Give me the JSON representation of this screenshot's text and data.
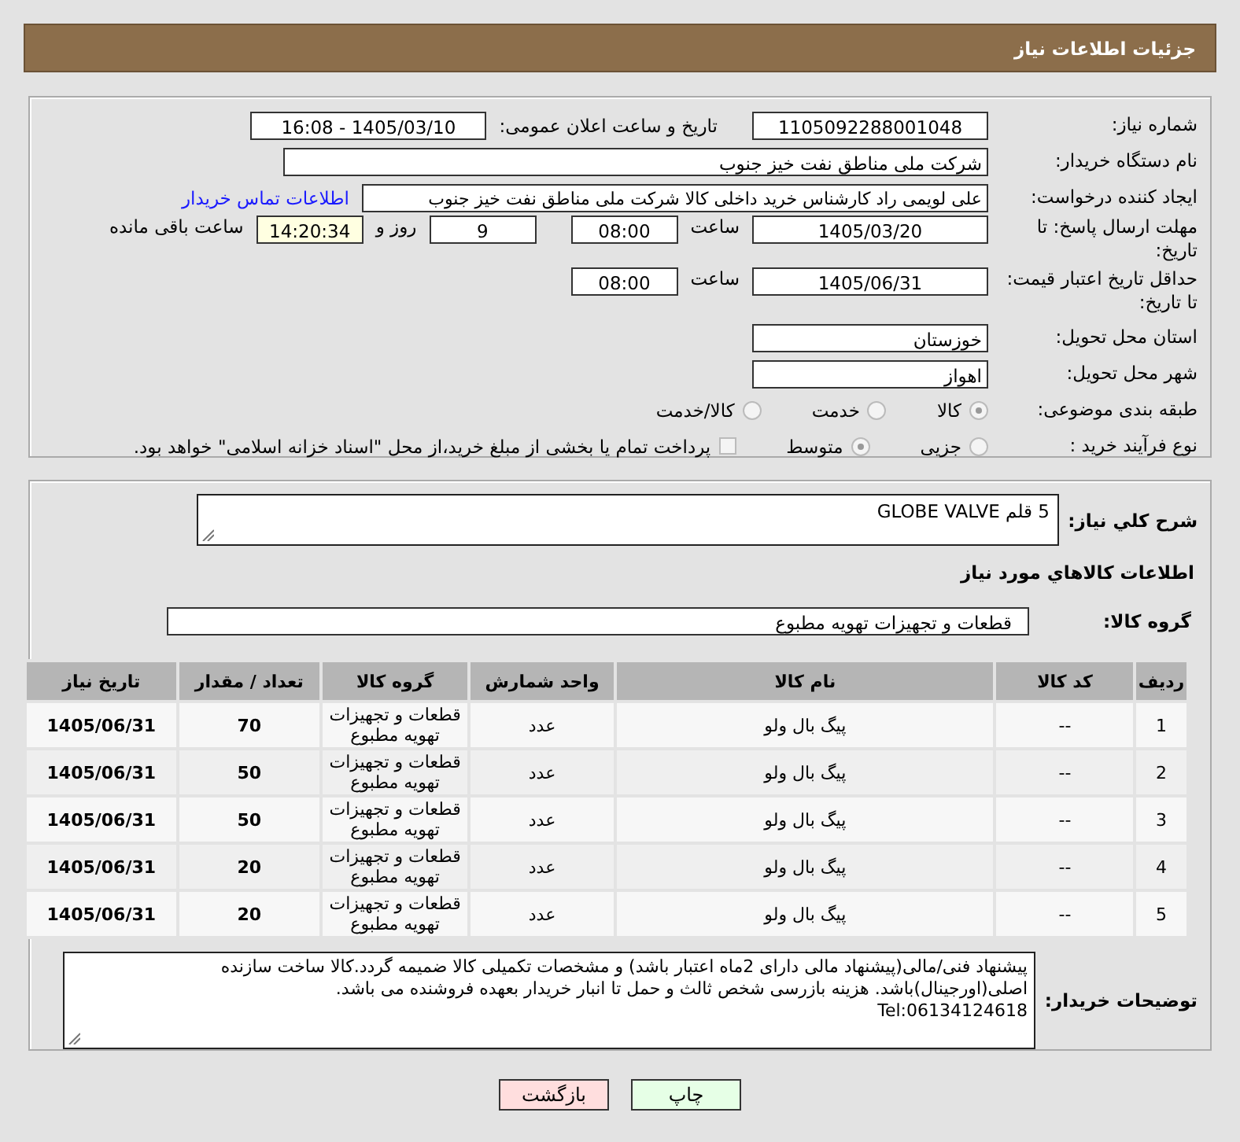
{
  "header": {
    "title": "جزئیات اطلاعات نیاز"
  },
  "need_number": {
    "label": "شماره نیاز:",
    "value": "1105092288001048"
  },
  "announce": {
    "label": "تاریخ و ساعت اعلان عمومی:",
    "value": "1405/03/10 - 16:08"
  },
  "buyer_org": {
    "label": "نام دستگاه خریدار:",
    "value": "شرکت ملی مناطق نفت خیز جنوب"
  },
  "requester": {
    "label": "ایجاد کننده درخواست:",
    "value": "علی  لویمی راد  کارشناس خرید داخلی کالا شرکت ملی مناطق نفت خیز جنوب",
    "link": "اطلاعات تماس خریدار"
  },
  "deadline": {
    "label": "مهلت ارسال پاسخ: تا تاریخ:",
    "date": "1405/03/20",
    "time_label": "ساعت",
    "time": "08:00",
    "days": "9",
    "days_label": "روز و",
    "remaining": "14:20:34",
    "remaining_label": "ساعت باقی مانده"
  },
  "validity": {
    "label": "حداقل تاریخ اعتبار قیمت: تا تاریخ:",
    "date": "1405/06/31",
    "time_label": "ساعت",
    "time": "08:00"
  },
  "province": {
    "label": "استان محل تحویل:",
    "value": "خوزستان"
  },
  "city": {
    "label": "شهر محل تحویل:",
    "value": "اهواز"
  },
  "category": {
    "label": "طبقه بندی موضوعی:",
    "options": [
      {
        "label": "کالا",
        "selected": true
      },
      {
        "label": "خدمت",
        "selected": false
      },
      {
        "label": "کالا/خدمت",
        "selected": false
      }
    ]
  },
  "process": {
    "label": "نوع فرآیند خرید :",
    "options": [
      {
        "label": "جزیی",
        "selected": false
      },
      {
        "label": "متوسط",
        "selected": true
      }
    ],
    "payment": {
      "label": "پرداخت تمام یا بخشی از مبلغ خرید،از محل \"اسناد خزانه اسلامی\" خواهد بود.",
      "checked": false
    }
  },
  "summary": {
    "label": "شرح کلي نياز:",
    "value": "5 قلم  GLOBE VALVE"
  },
  "items_title": "اطلاعات کالاهاي مورد نياز",
  "goods_group": {
    "label": "گروه کالا:",
    "value": "قطعات و تجهیزات تهویه مطبوع"
  },
  "table": {
    "columns": [
      "ردیف",
      "کد کالا",
      "نام کالا",
      "واحد شمارش",
      "گروه کالا",
      "تعداد / مقدار",
      "تاریخ نیاز"
    ],
    "rows": [
      [
        "1",
        "--",
        "پیگ بال ولو",
        "عدد",
        "قطعات و تجهیزات تهویه مطبوع",
        "70",
        "1405/06/31"
      ],
      [
        "2",
        "--",
        "پیگ بال ولو",
        "عدد",
        "قطعات و تجهیزات تهویه مطبوع",
        "50",
        "1405/06/31"
      ],
      [
        "3",
        "--",
        "پیگ بال ولو",
        "عدد",
        "قطعات و تجهیزات تهویه مطبوع",
        "50",
        "1405/06/31"
      ],
      [
        "4",
        "--",
        "پیگ بال ولو",
        "عدد",
        "قطعات و تجهیزات تهویه مطبوع",
        "20",
        "1405/06/31"
      ],
      [
        "5",
        "--",
        "پیگ بال ولو",
        "عدد",
        "قطعات و تجهیزات تهویه مطبوع",
        "20",
        "1405/06/31"
      ]
    ]
  },
  "notes": {
    "label": "توضیحات خریدار:",
    "lines": [
      "پیشنهاد فنی/مالی(پیشنهاد مالی دارای 2ماه اعتبار باشد) و مشخصات تکمیلی کالا ضمیمه گردد.کالا ساخت سازنده اصلی(اورجینال)باشد. هزینه بازرسی شخص ثالث و حمل تا انبار خریدار بعهده فروشنده می باشد.",
      "Tel:06134124618"
    ]
  },
  "buttons": [
    {
      "label": "چاپ",
      "kind": "print"
    },
    {
      "label": "بازگشت",
      "kind": "back"
    }
  ]
}
